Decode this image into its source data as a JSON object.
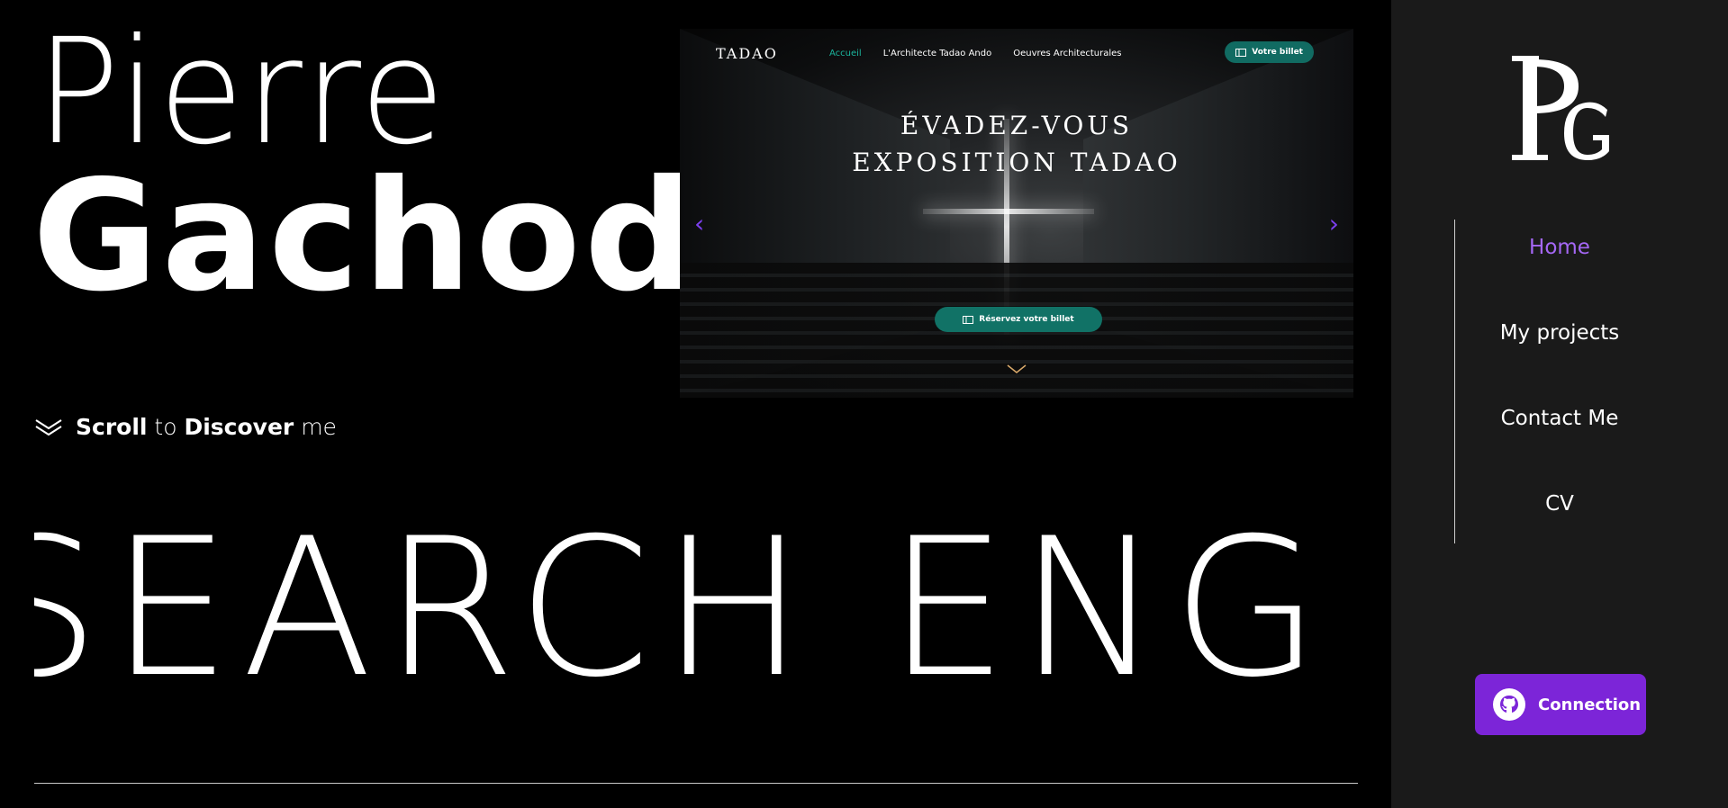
{
  "hero": {
    "first_name": "Pierre",
    "last_name": "Gachod",
    "scroll_word1": "Scroll",
    "scroll_word2": " to ",
    "scroll_word3": "Discover",
    "scroll_word4": " me"
  },
  "preview": {
    "logo": "TADAO",
    "nav": [
      "Accueil",
      "L'Architecte Tadao Ando",
      "Oeuvres Architecturales"
    ],
    "ticket_label": "Votre billet",
    "title_line1": "ÉVADEZ-VOUS",
    "title_line2": "EXPOSITION TADAO",
    "cta_label": "Réservez votre billet",
    "prev_arrow": "‹",
    "next_arrow": "›",
    "accent_color": "#1bb59d",
    "button_color": "#117266",
    "arrow_color": "#7c3ff0"
  },
  "marquee": {
    "text": "SEARCH ENGI"
  },
  "sidebar": {
    "monogram": "PG",
    "items": [
      {
        "label": "Home",
        "active": true
      },
      {
        "label": "My projects",
        "active": false
      },
      {
        "label": "Contact Me",
        "active": false
      },
      {
        "label": "CV",
        "active": false
      }
    ],
    "connect_label": "Connection",
    "active_color": "#a567f5",
    "button_color": "#7c25d8"
  }
}
